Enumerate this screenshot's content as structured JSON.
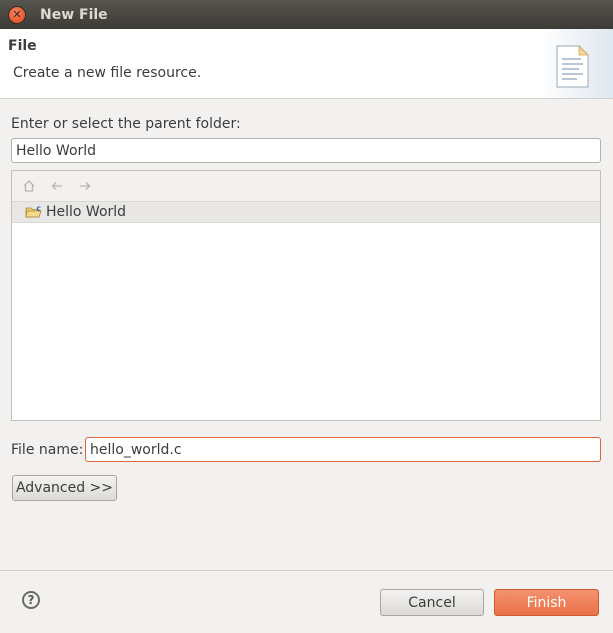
{
  "window": {
    "title": "New File"
  },
  "header": {
    "title": "File",
    "description": "Create a new file resource."
  },
  "parent_folder": {
    "label": "Enter or select the parent folder:",
    "value": "Hello World",
    "tree": {
      "items": [
        {
          "label": "Hello World",
          "selected": true
        }
      ]
    },
    "toolbar": {
      "icons": [
        "home-icon",
        "back-arrow-icon",
        "forward-arrow-icon"
      ]
    }
  },
  "file_name": {
    "label": "File name:",
    "value": "hello_world.c"
  },
  "buttons": {
    "advanced": "Advanced >>",
    "cancel": "Cancel",
    "finish": "Finish"
  },
  "colors": {
    "accent": "#ec7148",
    "titlebar": "#3c3b37"
  }
}
